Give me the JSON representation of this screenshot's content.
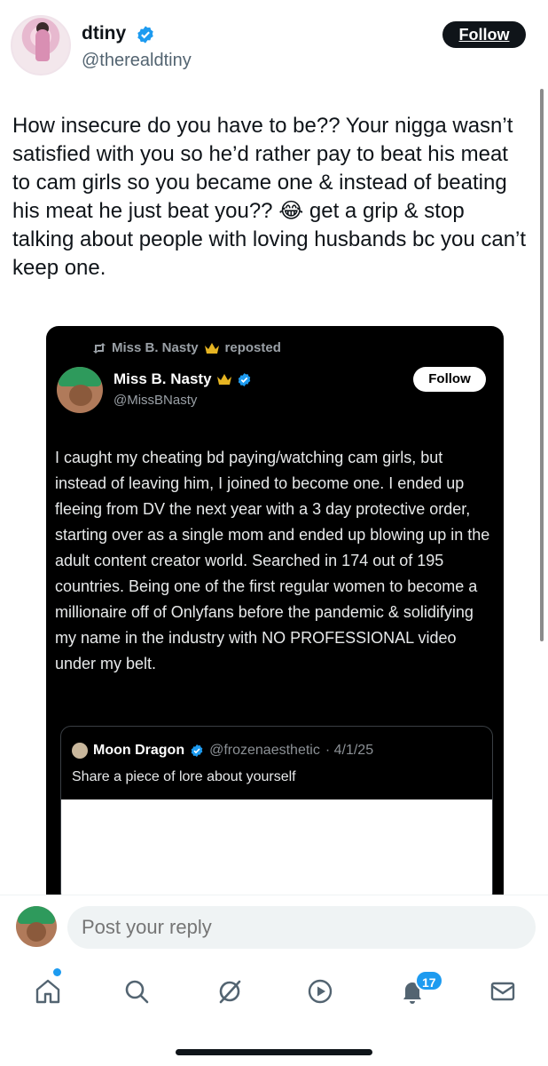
{
  "post": {
    "author_name": "dtiny",
    "author_handle": "@therealdtiny",
    "follow_label": "Follow",
    "text": "How insecure do you have to be?? Your nigga wasn’t satisfied with you so he’d rather pay to beat his meat to cam girls so you became one & instead of beating his meat he just beat you?? 😂 get a grip & stop talking about people with loving husbands bc you can’t keep one."
  },
  "quoted": {
    "repost_by": "Miss B. Nasty",
    "repost_suffix": "reposted",
    "author_name": "Miss B. Nasty",
    "author_handle": "@MissBNasty",
    "follow_label": "Follow",
    "text": "I caught my cheating bd paying/watching cam girls, but instead of leaving him, I joined to become one. I ended up fleeing from DV the next year with a 3 day protective order, starting over as a single mom and ended up blowing up in the adult content creator world. Searched in 174 out of 195 countries. Being one of the first regular women to become a millionaire off of Onlyfans before the pandemic & solidifying my name in the industry with NO PROFESSIONAL video under my belt.",
    "inner": {
      "author_name": "Moon Dragon",
      "author_handle": "@frozenaesthetic",
      "date": "· 4/1/25",
      "text": "Share a piece of lore about yourself"
    }
  },
  "reply": {
    "placeholder": "Post your reply"
  },
  "nav": {
    "items": [
      "home-icon",
      "search-icon",
      "grok-icon",
      "video-icon",
      "notifications-icon",
      "messages-icon"
    ],
    "notification_count": "17"
  },
  "colors": {
    "accent": "#1d9bf0",
    "text": "#0f1419",
    "secondary": "#536471"
  }
}
